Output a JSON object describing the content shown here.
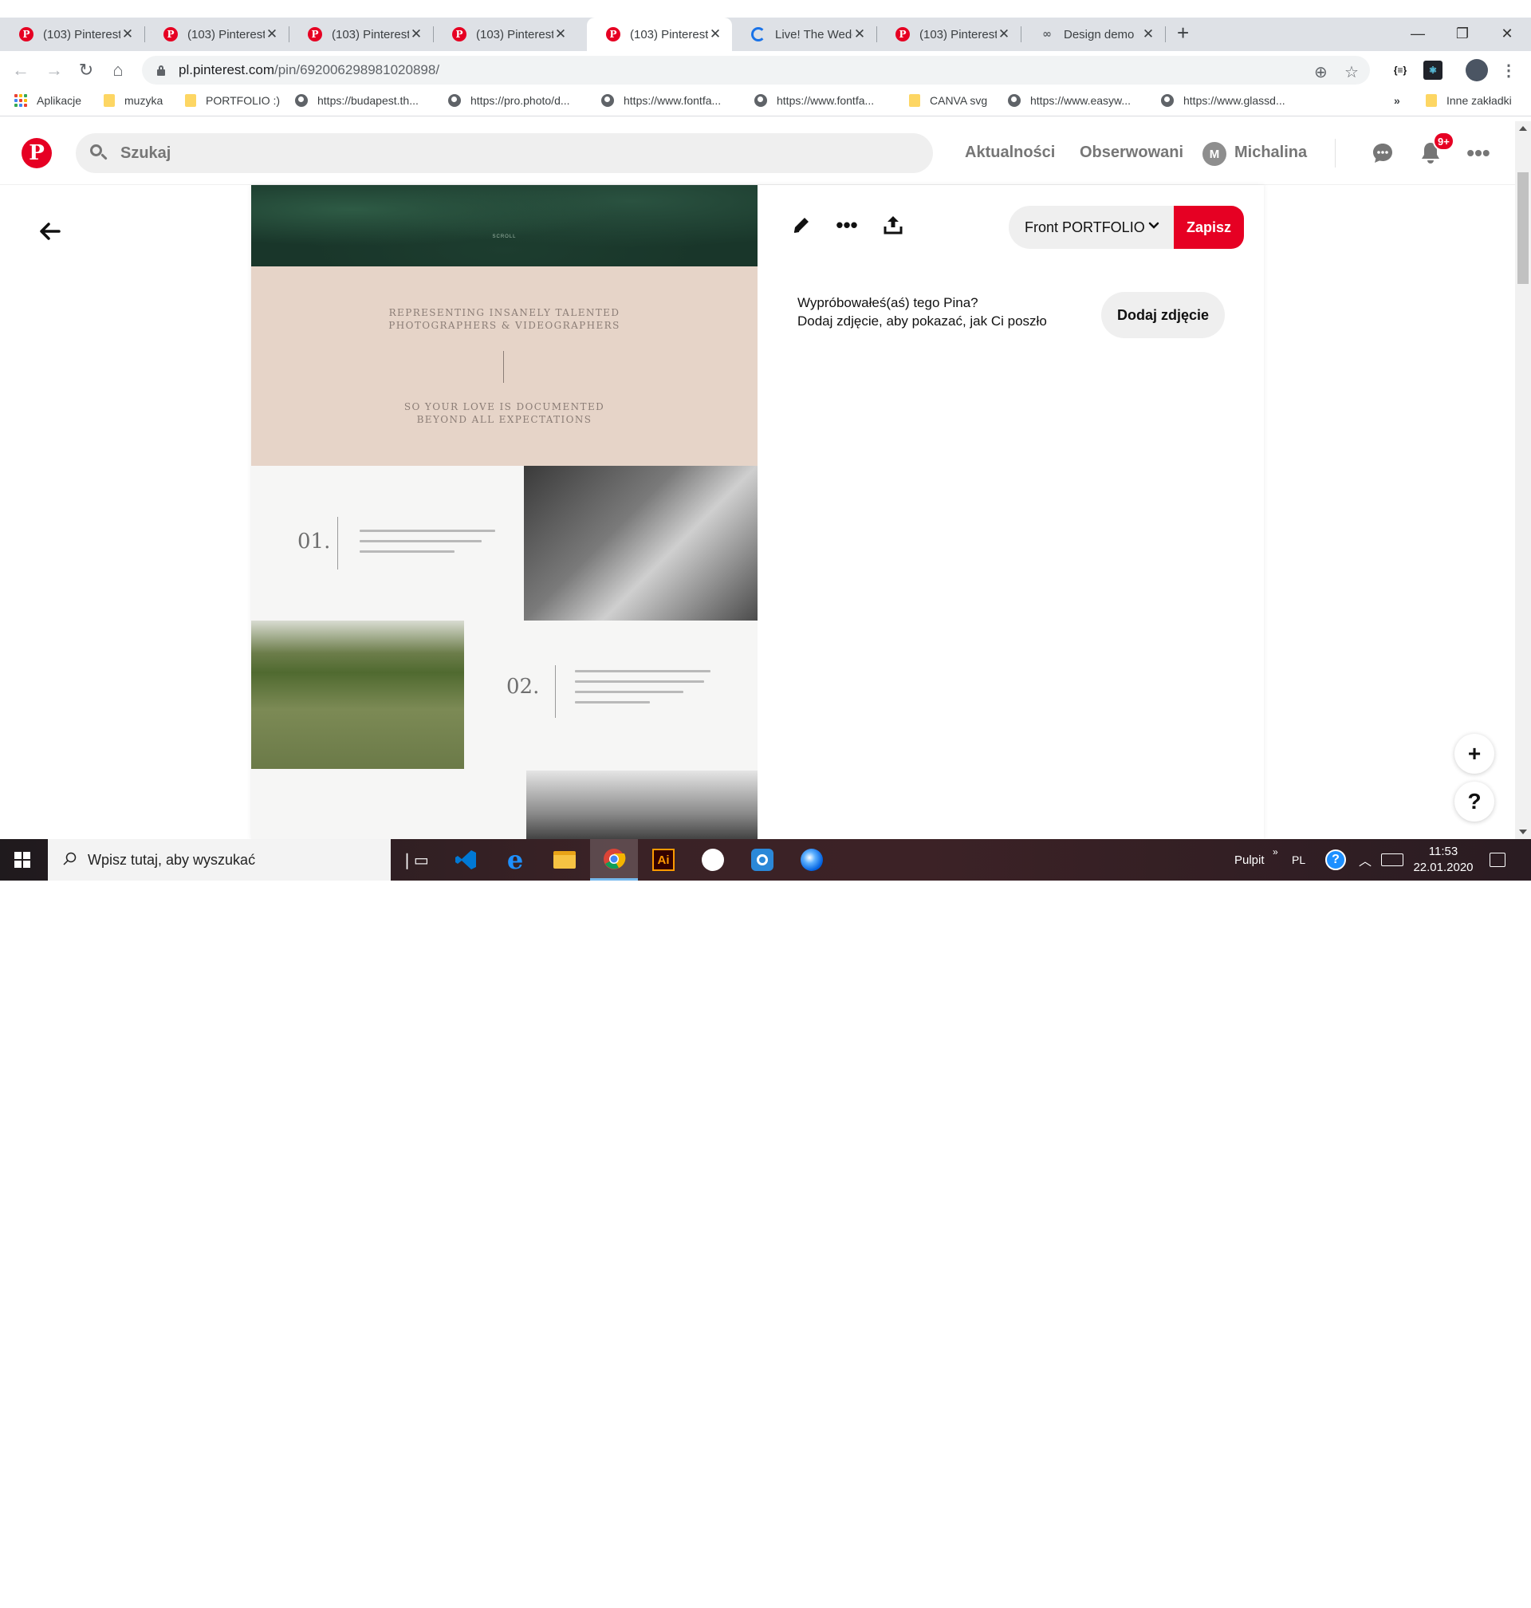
{
  "browser": {
    "tabs": [
      {
        "title": "(103) Pinterest",
        "icon": "pinterest-icon"
      },
      {
        "title": "(103) Pinterest",
        "icon": "pinterest-icon"
      },
      {
        "title": "(103) Pinterest",
        "icon": "pinterest-icon"
      },
      {
        "title": "(103) Pinterest",
        "icon": "pinterest-icon"
      },
      {
        "title": "(103) Pinterest",
        "icon": "pinterest-icon",
        "active": true
      },
      {
        "title": "Live! The Wedd",
        "icon": "loading-spinner-icon"
      },
      {
        "title": "(103) Pinterest",
        "icon": "pinterest-icon"
      },
      {
        "title": "Design demo ",
        "icon": "link-icon"
      }
    ],
    "url_host": "pl.pinterest.com",
    "url_path": "/pin/692006298981020898/",
    "bookmarks": [
      {
        "label": "Aplikacje",
        "icon": "apps-grid-icon"
      },
      {
        "label": "muzyka",
        "icon": "folder-icon"
      },
      {
        "label": "PORTFOLIO :)",
        "icon": "folder-icon"
      },
      {
        "label": "https://budapest.th...",
        "icon": "globe-icon"
      },
      {
        "label": "https://pro.photo/d...",
        "icon": "globe-icon"
      },
      {
        "label": "https://www.fontfa...",
        "icon": "globe-icon"
      },
      {
        "label": "https://www.fontfa...",
        "icon": "globe-icon"
      },
      {
        "label": "CANVA svg",
        "icon": "folder-icon"
      },
      {
        "label": "https://www.easyw...",
        "icon": "globe-icon"
      },
      {
        "label": "https://www.glassd...",
        "icon": "globe-icon"
      }
    ],
    "bookmarks_overflow": "»",
    "other_bookmarks": "Inne zakładki",
    "extension_label": "{≡}"
  },
  "pinterest": {
    "logo": "P",
    "search_placeholder": "Szukaj",
    "nav_home": "Aktualności",
    "nav_following": "Obserwowani",
    "user_initial": "M",
    "user_name": "Michalina",
    "notifications_badge": "9+",
    "brand_color": "#e60023"
  },
  "pin": {
    "image_scroll_label": "SCROLL",
    "image_line1": "REPRESENTING INSANELY TALENTED",
    "image_line2": "PHOTOGRAPHERS & VIDEOGRAPHERS",
    "image_line3": "SO YOUR LOVE IS DOCUMENTED",
    "image_line4": "BEYOND ALL EXPECTATIONS",
    "image_step1": "01.",
    "image_step2": "02.",
    "board_name": "Front PORTFOLIO",
    "save_label": "Zapisz",
    "tried_line1": "Wypróbowałeś(aś) tego Pina?",
    "tried_line2": "Dodaj zdjęcie, aby pokazać, jak Ci poszło",
    "add_photo_label": "Dodaj zdjęcie",
    "float_plus": "+",
    "float_help": "?"
  },
  "taskbar": {
    "search_placeholder": "Wpisz tutaj, aby wyszukać",
    "desktop_label": "Pulpit",
    "language": "PL",
    "time": "11:53",
    "date": "22.01.2020",
    "illustrator_label": "Ai"
  }
}
